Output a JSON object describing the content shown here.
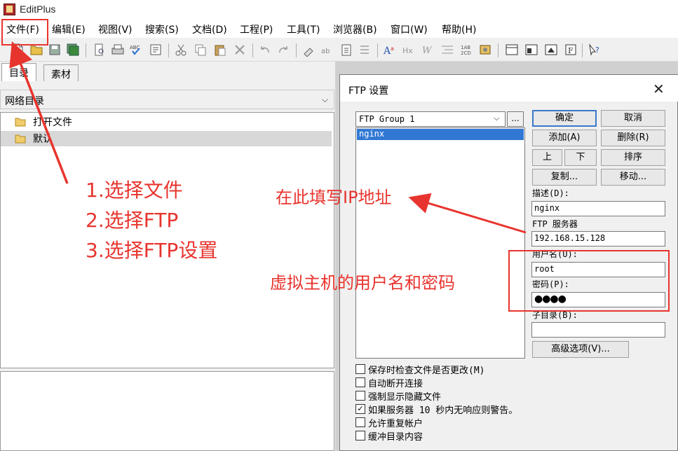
{
  "app": {
    "title": "EditPlus"
  },
  "menu": [
    "文件(F)",
    "编辑(E)",
    "视图(V)",
    "搜索(S)",
    "文档(D)",
    "工程(P)",
    "工具(T)",
    "浏览器(B)",
    "窗口(W)",
    "帮助(H)"
  ],
  "left": {
    "tabs": [
      "目录",
      "素材"
    ],
    "folder_combo": "网络目录",
    "items": [
      "打开文件",
      "默认"
    ]
  },
  "dialog": {
    "title": "FTP 设置",
    "group": "FTP Group 1",
    "more_button": "...",
    "sites": [
      "nginx"
    ],
    "buttons": {
      "ok": "确定",
      "cancel": "取消",
      "add": "添加(A)",
      "delete": "删除(R)",
      "up": "上",
      "down": "下",
      "sort": "排序",
      "copy": "复制...",
      "move": "移动..."
    },
    "fields": {
      "desc_label": "描述(D):",
      "desc_value": "nginx",
      "server_label": "FTP 服务器",
      "server_value": "192.168.15.128",
      "user_label": "用户名(U):",
      "user_value": "root",
      "pass_label": "密码(P):",
      "pass_value": "●●●●",
      "subdir_label": "子目录(B):",
      "subdir_value": ""
    },
    "advanced_button": "高级选项(V)...",
    "checkboxes": [
      {
        "label": "保存时检查文件是否更改(M)",
        "checked": false
      },
      {
        "label": "自动断开连接",
        "checked": false
      },
      {
        "label": "强制显示隐藏文件",
        "checked": false
      },
      {
        "label": "如果服务器 10 秒内无响应则警告。",
        "checked": true
      },
      {
        "label": "允许重复帐户",
        "checked": false
      },
      {
        "label": "缓冲目录内容",
        "checked": false
      }
    ]
  },
  "annotations": {
    "steps": [
      "1.选择文件",
      "2.选择FTP",
      "3.选择FTP设置"
    ],
    "ip_hint": "在此填写IP地址",
    "cred_hint": "虚拟主机的用户名和密码",
    "color": "#e8342e"
  }
}
